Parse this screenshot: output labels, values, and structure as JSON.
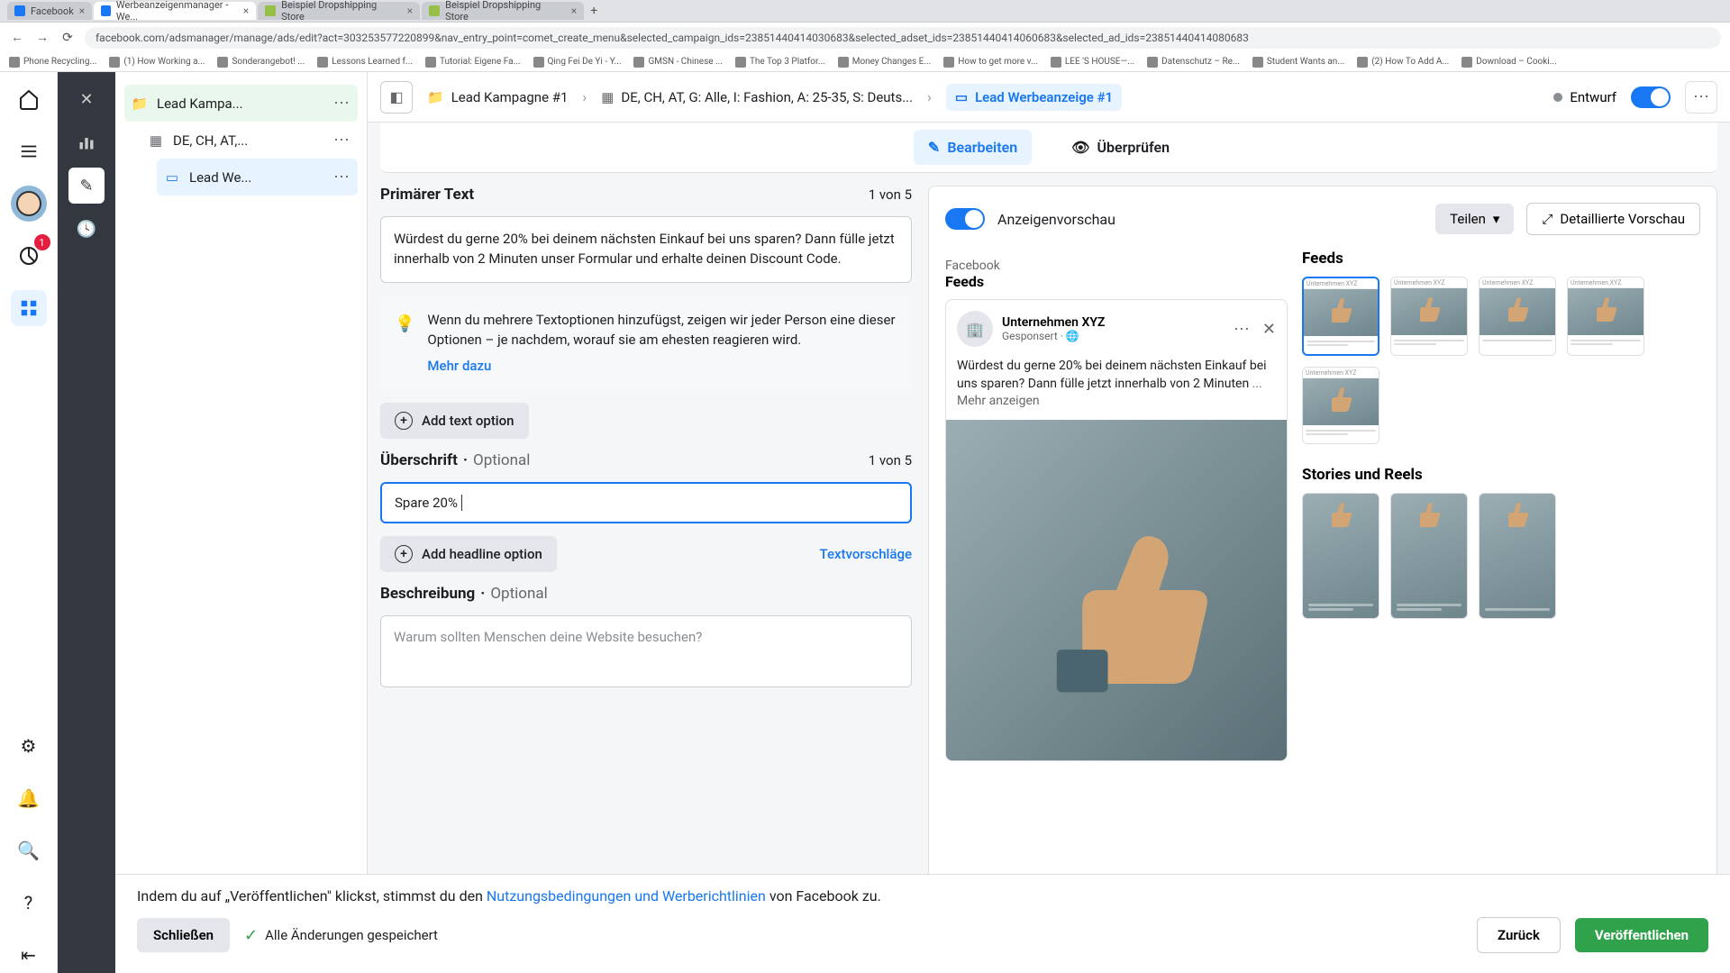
{
  "browser": {
    "tabs": [
      {
        "label": "Facebook"
      },
      {
        "label": "Werbeanzeigenmanager - We..."
      },
      {
        "label": "Beispiel Dropshipping Store"
      },
      {
        "label": "Beispiel Dropshipping Store"
      }
    ],
    "url": "facebook.com/adsmanager/manage/ads/edit?act=303253577220899&nav_entry_point=comet_create_menu&selected_campaign_ids=23851440414030683&selected_adset_ids=23851440414060683&selected_ad_ids=23851440414080683",
    "bookmarks": [
      "Phone Recycling...",
      "(1) How Working a...",
      "Sonderangebot! ...",
      "Lessons Learned f...",
      "Tutorial: Eigene Fa...",
      "Qing Fei De Yi - Y...",
      "GMSN - Chinese ...",
      "The Top 3 Platfor...",
      "Money Changes E...",
      "How to get more v...",
      "LEE 'S HOUSE—...",
      "Datenschutz – Re...",
      "Student Wants an...",
      "(2) How To Add A...",
      "Download – Cooki..."
    ]
  },
  "fb_rail": {
    "badge": "1"
  },
  "tree": {
    "campaign": "Lead Kampa...",
    "adset": "DE, CH, AT,...",
    "ad": "Lead We..."
  },
  "breadcrumb": {
    "campaign": "Lead Kampagne #1",
    "adset": "DE, CH, AT, G: Alle, I: Fashion, A: 25-35, S: Deuts...",
    "ad": "Lead Werbeanzeige #1",
    "draft": "Entwurf"
  },
  "tabs": {
    "edit": "Bearbeiten",
    "review": "Überprüfen"
  },
  "form": {
    "primary_text_label": "Primärer Text",
    "counter": "1 von 5",
    "primary_text": "Würdest du gerne 20% bei deinem nächsten Einkauf bei uns sparen? Dann fülle jetzt innerhalb von 2 Minuten unser Formular und erhalte deinen Discount Code.",
    "info": "Wenn du mehrere Textoptionen hinzufügst, zeigen wir jeder Person eine dieser Optionen – je nachdem, worauf sie am ehesten reagieren wird.",
    "info_link": "Mehr dazu",
    "add_text": "Add text option",
    "headline_label": "Überschrift",
    "optional": "Optional",
    "headline_value": "Spare 20%",
    "add_headline": "Add headline option",
    "text_sugg": "Textvorschläge",
    "desc_label": "Beschreibung",
    "desc_placeholder": "Warum sollten Menschen deine Website besuchen?"
  },
  "preview": {
    "title": "Anzeigenvorschau",
    "share": "Teilen",
    "detail": "Detaillierte Vorschau",
    "fb_label": "Facebook",
    "feeds": "Feeds",
    "advertiser": "Unternehmen XYZ",
    "sponsored": "Gesponsert · 🌐",
    "ad_text": "Würdest du gerne 20% bei deinem nächsten Einkauf bei uns sparen? Dann fülle jetzt innerhalb von 2 Minuten",
    "more": "... Mehr anzeigen",
    "placements_feeds": "Feeds",
    "placements_stories": "Stories und Reels"
  },
  "footer": {
    "text_pre": "Indem du auf „Veröffentlichen\" klickst, stimmst du den ",
    "link": "Nutzungsbedingungen und Werberichtlinien",
    "text_post": " von Facebook zu.",
    "close": "Schließen",
    "saved": "Alle Änderungen gespeichert",
    "back": "Zurück",
    "publish": "Veröffentlichen"
  }
}
